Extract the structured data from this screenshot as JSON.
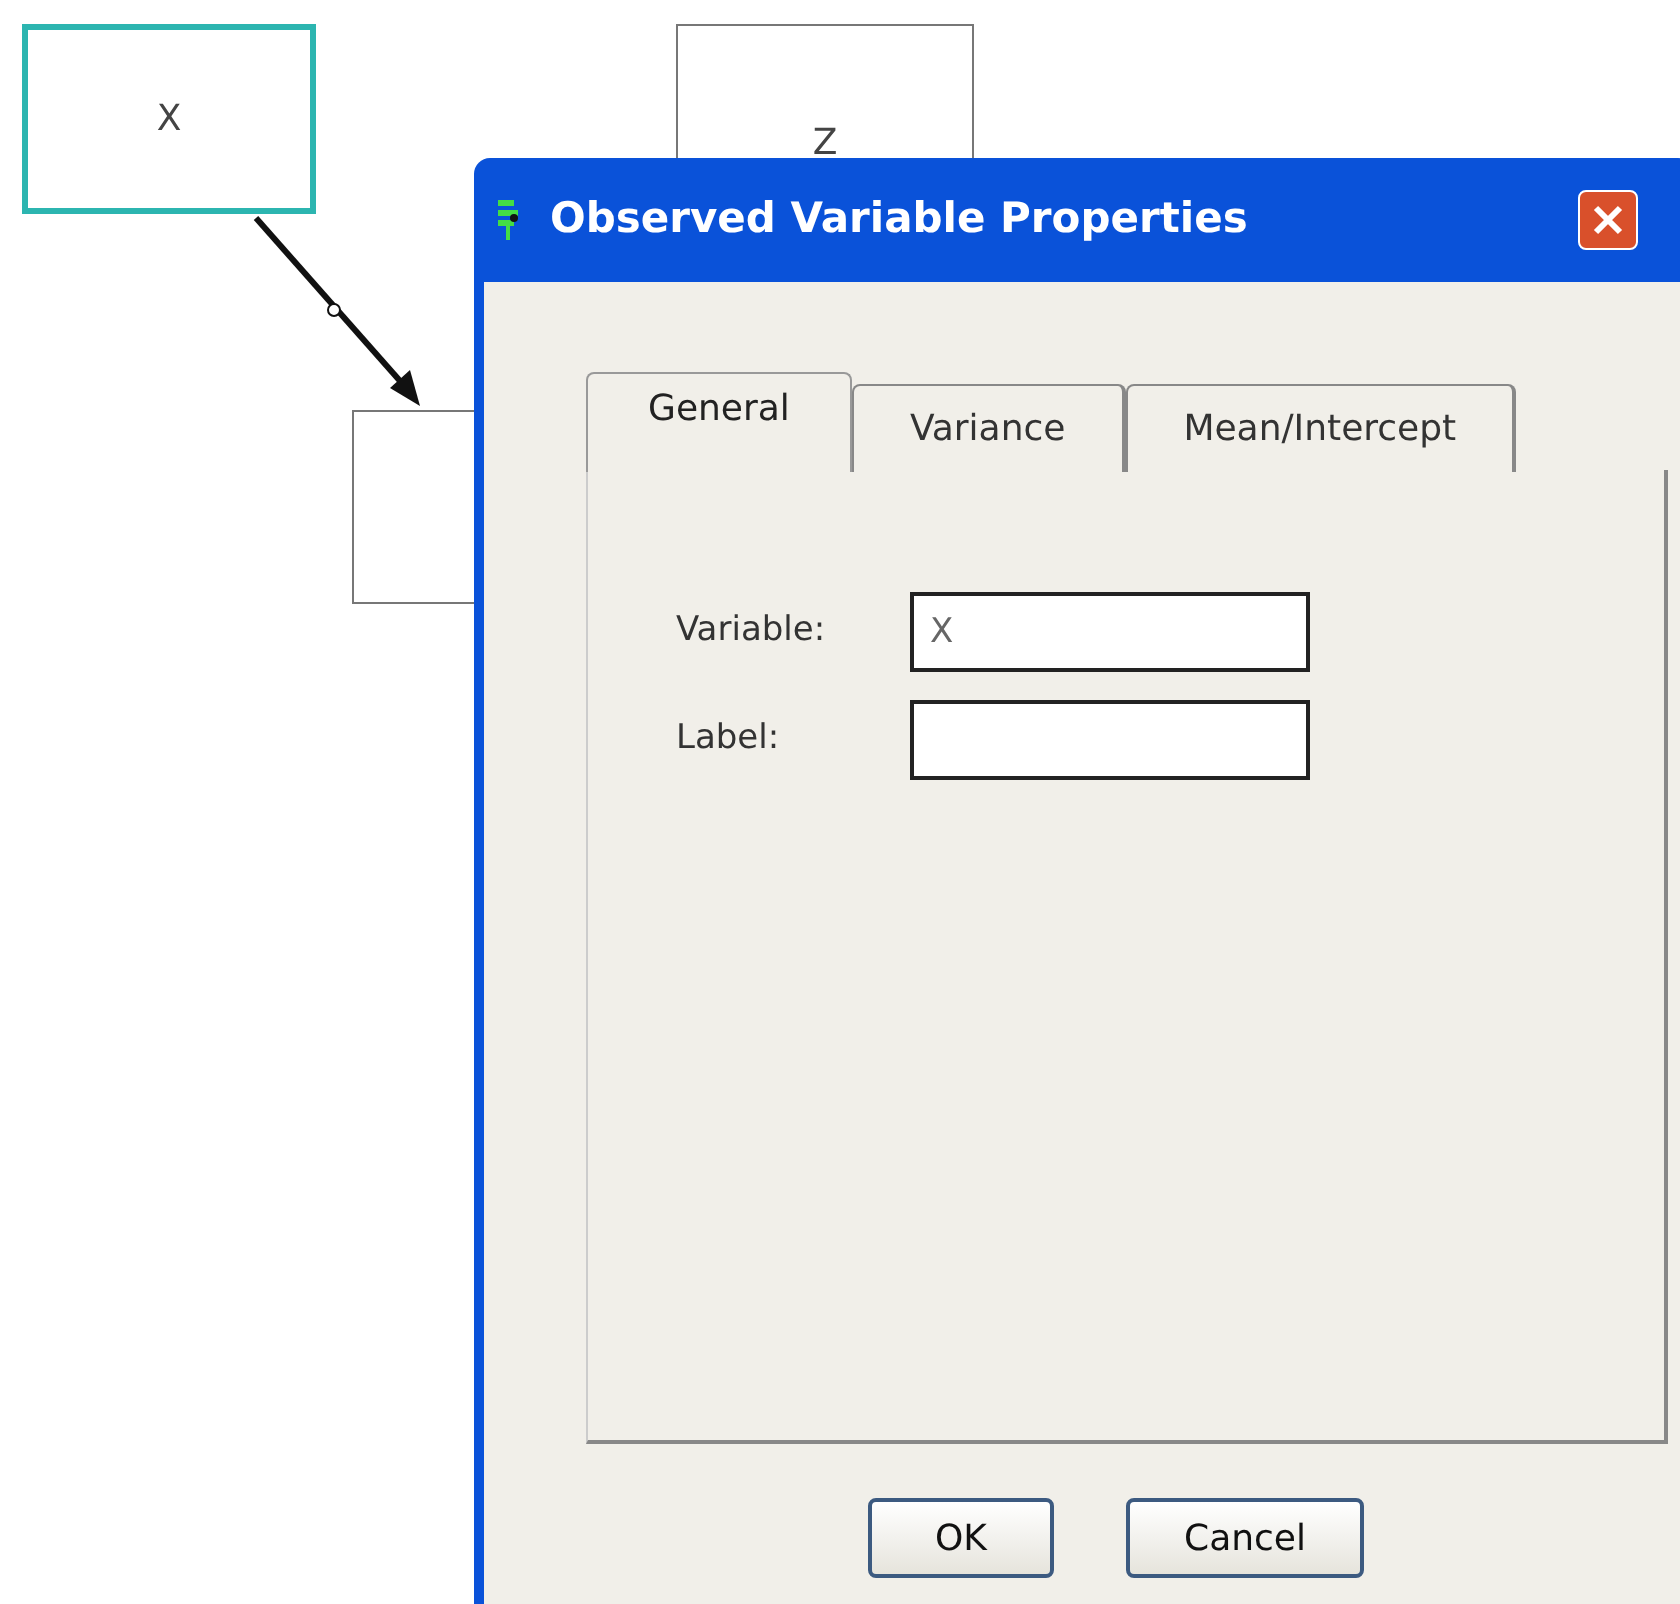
{
  "diagram": {
    "nodes": [
      {
        "label": "X",
        "selected": true
      },
      {
        "label": "Z",
        "selected": false
      },
      {
        "selected": false
      }
    ]
  },
  "dialog": {
    "title": "Observed Variable Properties",
    "tabs": [
      {
        "label": "General",
        "selected": true
      },
      {
        "label": "Variance",
        "selected": false
      },
      {
        "label": "Mean/Intercept",
        "selected": false
      }
    ],
    "fields": [
      {
        "label": "Variable:",
        "value": "X"
      },
      {
        "label": "Label:"
      }
    ],
    "buttons": [
      "OK",
      "Cancel"
    ]
  }
}
